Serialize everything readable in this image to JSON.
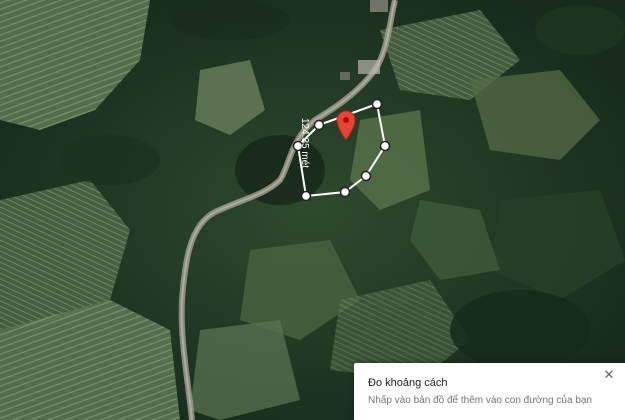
{
  "measure_path": {
    "distance_label": "124.35 mét"
  },
  "measure_panel": {
    "title": "Đo khoảng cách",
    "hint": "Nhấp vào bản đồ để thêm vào con đường của bạn",
    "close_icon": "close-icon"
  },
  "pin": {
    "icon": "location-pin-icon",
    "color": "#ea4335"
  },
  "colors": {
    "path": "#ffffff",
    "vertex_fill": "#ffffff",
    "vertex_stroke": "#222222"
  }
}
